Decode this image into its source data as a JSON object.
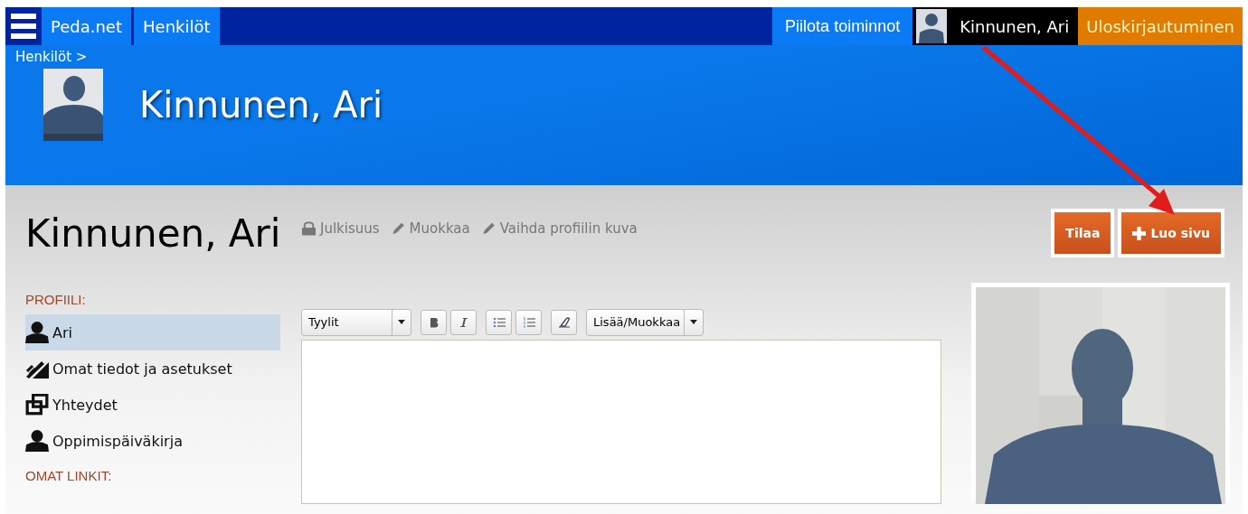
{
  "topbar": {
    "links": [
      {
        "label": "Peda.net"
      },
      {
        "label": "Henkilöt"
      }
    ],
    "hide_actions": "Piilota toiminnot",
    "user": "Kinnunen, Ari",
    "logout": "Uloskirjautuminen"
  },
  "header": {
    "breadcrumb": "Henkilöt >",
    "title": "Kinnunen, Ari"
  },
  "page": {
    "title": "Kinnunen, Ari",
    "actions": [
      {
        "kind": "lock",
        "label": "Julkisuus"
      },
      {
        "kind": "pencil",
        "label": "Muokkaa"
      },
      {
        "kind": "pencil",
        "label": "Vaihda profiilin kuva"
      }
    ],
    "buttons": [
      {
        "kind": "plain",
        "label": "Tilaa"
      },
      {
        "kind": "plus",
        "label": "Luo sivu"
      }
    ]
  },
  "sidebar": {
    "sections": [
      {
        "heading": "PROFIILI:",
        "items": [
          {
            "kind": "person",
            "label": "Ari",
            "selected": true
          },
          {
            "kind": "tools",
            "label": "Omat tiedot ja asetukset",
            "selected": false
          },
          {
            "kind": "windows",
            "label": "Yhteydet",
            "selected": false
          },
          {
            "kind": "person",
            "label": "Oppimispäiväkirja",
            "selected": false
          }
        ]
      },
      {
        "heading": "OMAT LINKIT:"
      }
    ]
  },
  "editor": {
    "styles": "Tyylit",
    "insert": "Lisää/Muokkaa"
  }
}
